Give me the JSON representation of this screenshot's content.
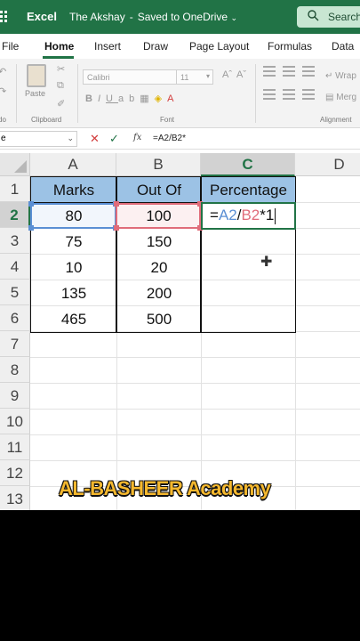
{
  "titlebar": {
    "app_name": "Excel",
    "doc_name": "The Akshay",
    "separator": "-",
    "save_status": "Saved to OneDrive",
    "search_label": "Search"
  },
  "tabs": [
    "File",
    "Home",
    "Insert",
    "Draw",
    "Page Layout",
    "Formulas",
    "Data"
  ],
  "active_tab": "Home",
  "ribbon": {
    "paste_label": "Paste",
    "clipboard_group": "Clipboard",
    "font_name": "Calibri",
    "font_size": "11",
    "font_group": "Font",
    "alignment_group": "Alignment",
    "wrap_label": "Wrap",
    "merge_label": "Merg",
    "undo_group": "do"
  },
  "formula_bar": {
    "namebox_text": "e",
    "cancel": "✕",
    "enter": "✓",
    "fx": "fx",
    "formula": "=A2/B2*"
  },
  "columns": [
    "A",
    "B",
    "C",
    "D"
  ],
  "selected_column": "C",
  "rows": [
    "1",
    "2",
    "3",
    "4",
    "5",
    "6",
    "7",
    "8",
    "9",
    "10",
    "11",
    "12",
    "13"
  ],
  "selected_row": "2",
  "table": {
    "headers": [
      "Marks",
      "Out Of",
      "Percentage"
    ],
    "data": [
      [
        "80",
        "100"
      ],
      [
        "75",
        "150"
      ],
      [
        "10",
        "20"
      ],
      [
        "135",
        "200"
      ],
      [
        "465",
        "500"
      ]
    ]
  },
  "active_cell": {
    "eq": "=",
    "ref_a": "A2",
    "slash": "/",
    "ref_b": "B2",
    "rest": "*1"
  },
  "watermark": "AL-BASHEER Academy",
  "colors": {
    "excel_green": "#217346",
    "header_fill": "#9cc2e5",
    "ref_a": "#5b8fd4",
    "ref_b": "#e06c7a",
    "watermark": "#f5b82e"
  }
}
